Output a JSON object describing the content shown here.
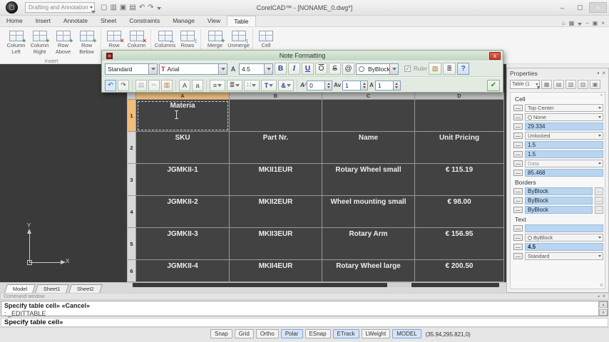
{
  "titlebar": {
    "workspace": "Drafting and Annotation",
    "title": "CorelCAD™ - [NONAME_0.dwg*]",
    "min": "–",
    "max": "▢",
    "close": "×",
    "qat": [
      "▢",
      "▥",
      "▣",
      "▤",
      "↶",
      "↷"
    ]
  },
  "doc_controls": {
    "home": "⌂",
    "panel": "▦",
    "min": "–",
    "restore": "▣",
    "close": "×"
  },
  "ribbon": {
    "tabs": [
      "Home",
      "Insert",
      "Annotate",
      "Sheet",
      "Constraints",
      "Manage",
      "View",
      "Table"
    ],
    "active_tab": "Table",
    "insert_group_label": "Insert",
    "items": [
      {
        "label": "Column Left"
      },
      {
        "label": "Column Right"
      },
      {
        "label": "Row Above"
      },
      {
        "label": "Row Below"
      },
      {
        "label": "Row"
      },
      {
        "label": "Column"
      },
      {
        "label": "Columns"
      },
      {
        "label": "Rows"
      },
      {
        "label": "Merge"
      },
      {
        "label": "Unmerge"
      },
      {
        "label": "Cell"
      }
    ]
  },
  "dialog": {
    "title": "Note Formatting",
    "style_value": "Standard",
    "font_badge": "T",
    "font_value": "Arial",
    "size_badge": "A",
    "size_value": "4.5",
    "bold": "B",
    "italic": "I",
    "underline": "U",
    "overline": "O",
    "strike": "S",
    "symbol": "@",
    "color_value": "ByBlock",
    "ruler_check": "✓",
    "ruler_label": "Ruler",
    "bg_tool": "▨",
    "options_tool": "≣",
    "help": "?",
    "undo": "↶",
    "redo": "↷",
    "copy": "▤",
    "cut": "✂",
    "paste": "▥",
    "upper": "A",
    "lower": "a",
    "spacing": "≡",
    "justify": "≣",
    "list": "∷",
    "textdir": "T",
    "symbol2": "&",
    "oblique_label": "A∕",
    "oblique_value": "0",
    "tracking_label": "Av",
    "tracking_value": "1",
    "width_label": "A",
    "width_value": "1",
    "ok": "✔"
  },
  "table": {
    "columns": [
      "A",
      "B",
      "C",
      "D"
    ],
    "selected_column": "A",
    "rows": [
      {
        "n": "1",
        "cells": [
          "Materia",
          "",
          "",
          ""
        ]
      },
      {
        "n": "2",
        "cells": [
          "SKU",
          "Part Nr.",
          "Name",
          "Unit Pricing"
        ]
      },
      {
        "n": "3",
        "cells": [
          "JGMKII-1",
          "MKII1EUR",
          "Rotary Wheel small",
          "€ 115.19"
        ]
      },
      {
        "n": "4",
        "cells": [
          "JGMKII-2",
          "MKII2EUR",
          "Wheel mounting small",
          "€ 98.00"
        ]
      },
      {
        "n": "5",
        "cells": [
          "JGMKII-3",
          "MKII3EUR",
          "Rotary Arm",
          "€ 156.95"
        ]
      },
      {
        "n": "6",
        "cells": [
          "JGMKII-4",
          "MKII4EUR",
          "Rotary Wheel large",
          "€ 200.50"
        ]
      }
    ]
  },
  "ucs": {
    "x": "X",
    "y": "Y"
  },
  "properties": {
    "header": "Properties",
    "pin": "▪",
    "close": "×",
    "selector": "Table (1",
    "toolbar_icons": [
      "▦",
      "▤",
      "▧",
      "▥",
      "▣"
    ],
    "collapse": "^",
    "scroll": "v",
    "cell_label": "Cell",
    "cell": {
      "alignment": "Top Center",
      "background": "None",
      "width": "29.334",
      "lock": "Unlocked",
      "margin_h": "1.5",
      "margin_v": "1.5",
      "style": "Data",
      "size": "85.468"
    },
    "borders_label": "Borders",
    "borders": [
      "ByBlock",
      "ByBlock",
      "ByBlock"
    ],
    "ellipsis": "…",
    "text_label": "Text",
    "text": {
      "content": "",
      "color": "ByBlock",
      "height": "4.5",
      "style": "Standard"
    }
  },
  "sheetbar": {
    "tabs": [
      "Model",
      "Sheet1",
      "Sheet2"
    ]
  },
  "command": {
    "title": "Command window",
    "pin": "▪",
    "close": "×",
    "line1": "Specify table cell» «Cancel»",
    "line2": ": _EDITTABLE",
    "prompt": "Specify table cell»",
    "scroll_up": "▴",
    "scroll_down": "▾"
  },
  "statusbar": {
    "buttons": [
      {
        "label": "Snap",
        "active": false
      },
      {
        "label": "Grid",
        "active": false
      },
      {
        "label": "Ortho",
        "active": false
      },
      {
        "label": "Polar",
        "active": true
      },
      {
        "label": "ESnap",
        "active": false
      },
      {
        "label": "ETrack",
        "active": true
      },
      {
        "label": "LWeight",
        "active": false
      },
      {
        "label": "MODEL",
        "active": true
      }
    ],
    "coords": "(35.94,295.821,0)"
  },
  "colors": {
    "canvas": "#3a3a3a",
    "selection_orange": "#efbe7a",
    "dialog_green": "#e2eae2",
    "value_blue": "#b9d5f0",
    "close_red": "#c9362b"
  }
}
